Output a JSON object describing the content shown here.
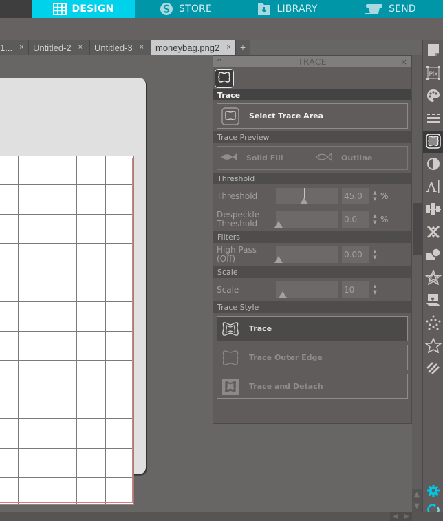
{
  "topnav": {
    "tabs": [
      {
        "label": "DESIGN",
        "icon": "grid-icon",
        "active": true
      },
      {
        "label": "STORE",
        "icon": "silhouette-s-icon",
        "active": false
      },
      {
        "label": "LIBRARY",
        "icon": "library-download-icon",
        "active": false
      },
      {
        "label": "SEND",
        "icon": "cutter-icon",
        "active": false
      }
    ]
  },
  "doc_tabs": [
    {
      "label": "1...",
      "close": "×"
    },
    {
      "label": "Untitled-2",
      "close": "×"
    },
    {
      "label": "Untitled-3",
      "close": "×"
    },
    {
      "label": "moneybag.png2",
      "close": "×",
      "active": true
    }
  ],
  "doc_tabs_add": "+",
  "trace_panel": {
    "title": "TRACE",
    "collapse_icon": "^",
    "close_icon": "×",
    "sections": {
      "trace": "Trace",
      "trace_preview": "Trace Preview",
      "threshold": "Threshold",
      "filters": "Filters",
      "scale": "Scale",
      "trace_style": "Trace Style"
    },
    "select_trace_area": "Select Trace Area",
    "preview_options": {
      "solid_fill": "Solid Fill",
      "outline": "Outline"
    },
    "controls": {
      "threshold": {
        "label": "Threshold",
        "value": "45.0",
        "unit": "%",
        "slider_fraction": 0.45
      },
      "despeckle": {
        "label": "Despeckle Threshold",
        "value": "0.0",
        "unit": "%",
        "slider_fraction": 0.0
      },
      "high_pass": {
        "label": "High Pass (Off)",
        "value": "0.00",
        "unit": "",
        "slider_fraction": 0.0
      },
      "scale": {
        "label": "Scale",
        "value": "10",
        "unit": "",
        "slider_fraction": 0.07
      }
    },
    "trace_styles": [
      {
        "label": "Trace",
        "selected": true
      },
      {
        "label": "Trace Outer Edge",
        "selected": false
      },
      {
        "label": "Trace and Detach",
        "selected": false
      }
    ]
  },
  "right_toolbar": [
    "page-setup-icon",
    "pixscan-icon",
    "fill-palette-icon",
    "line-style-icon",
    "trace-icon",
    "transparency-icon",
    "text-style-icon",
    "align-icon",
    "replicate-icon",
    "modify-icon",
    "offset-icon",
    "sketch-icon",
    "rhinestone-icon",
    "star-favorites-icon",
    "knife-eraser-icon"
  ],
  "colors": {
    "accent": "#00d2ec",
    "nav_bg": "#0096a8",
    "panel_bg": "#5f5c5b",
    "mat_red_line": "#e8747a"
  }
}
